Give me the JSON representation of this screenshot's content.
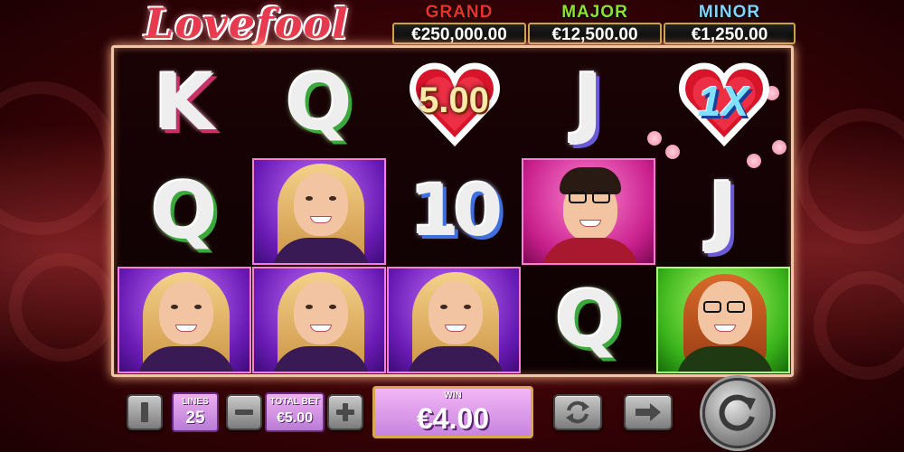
{
  "game": {
    "title": "Lovefool",
    "jackpots": [
      {
        "label": "GRAND",
        "value": "€250,000.00",
        "color": "#d62a2a"
      },
      {
        "label": "MAJOR",
        "value": "€12,500.00",
        "color": "#7fd62a"
      },
      {
        "label": "MINOR",
        "value": "€1,250.00",
        "color": "#5ec7ff"
      }
    ]
  },
  "reels": {
    "row1": {
      "col1": {
        "symbol": "K",
        "kind": "letter"
      },
      "col2": {
        "symbol": "Q",
        "kind": "letter"
      },
      "col3": {
        "symbol": "heart",
        "kind": "cash-heart",
        "text": "5.00"
      },
      "col4": {
        "symbol": "J",
        "kind": "letter"
      },
      "col5": {
        "symbol": "heart",
        "kind": "multiplier-heart",
        "text": "1X"
      }
    },
    "row2": {
      "col1": {
        "symbol": "Q",
        "kind": "letter"
      },
      "col2": {
        "symbol": "blonde-woman",
        "kind": "portrait"
      },
      "col3": {
        "symbol": "10",
        "kind": "letter"
      },
      "col4": {
        "symbol": "man-with-glasses",
        "kind": "portrait"
      },
      "col5": {
        "symbol": "J",
        "kind": "letter"
      }
    },
    "row3": {
      "col1": {
        "symbol": "blonde-woman",
        "kind": "portrait"
      },
      "col2": {
        "symbol": "blonde-woman",
        "kind": "portrait"
      },
      "col3": {
        "symbol": "blonde-woman",
        "kind": "portrait"
      },
      "col4": {
        "symbol": "Q",
        "kind": "letter"
      },
      "col5": {
        "symbol": "redhead-woman-with-glasses",
        "kind": "portrait"
      }
    }
  },
  "controls": {
    "info_icon": "info-icon",
    "lines_label": "LINES",
    "lines_value": "25",
    "minus_icon": "minus-icon",
    "total_bet_label": "TOTAL BET",
    "total_bet_value": "€5.00",
    "plus_icon": "plus-icon",
    "win_label": "WIN",
    "win_value": "€4.00",
    "autoplay_icon": "autoplay-icon",
    "turbo_icon": "fast-forward-icon",
    "spin_icon": "spin-icon"
  }
}
